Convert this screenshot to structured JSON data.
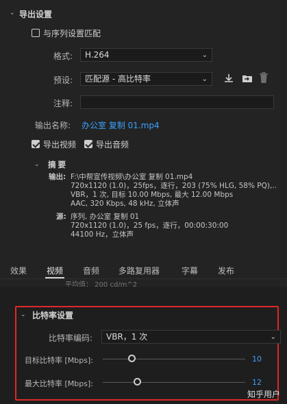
{
  "export": {
    "section_title": "导出设置",
    "match_sequence_label": "与序列设置匹配",
    "format_label": "格式:",
    "format_value": "H.264",
    "preset_label": "预设:",
    "preset_value": "匹配源 - 高比特率",
    "comment_label": "注释:",
    "comment_value": "",
    "output_name_label": "输出名称:",
    "output_name_value": "办公室 复制 01.mp4",
    "export_video_label": "导出视频",
    "export_audio_label": "导出音频"
  },
  "summary": {
    "title": "摘要",
    "output_label": "输出:",
    "output_lines": [
      "F:\\中帮宣传视频\\办公室 复制 01.mp4",
      "720x1120 (1.0)，25fps，逐行，203 (75% HLG, 58% PQ),..",
      "VBR，1 次, 目标 10.00 Mbps, 最大 12.00 Mbps",
      "AAC, 320 Kbps, 48  kHz, 立体声"
    ],
    "source_label": "源:",
    "source_lines": [
      "序列, 办公室 复制 01",
      "720x1120 (1.0)，25 fps，逐行，00:00:30:00",
      "44100 Hz，立体声"
    ]
  },
  "tabs": [
    {
      "label": "效果"
    },
    {
      "label": "视频"
    },
    {
      "label": "音频"
    },
    {
      "label": "多路复用器"
    },
    {
      "label": "字幕"
    },
    {
      "label": "发布"
    }
  ],
  "faded_text": "平均值：  200 cd/m^2",
  "bitrate": {
    "section_title": "比特率设置",
    "encoding_label": "比特率编码:",
    "encoding_value": "VBR，1 次",
    "target_label": "目标比特率 [Mbps]:",
    "target_value": "10",
    "max_label": "最大比特率 [Mbps]:",
    "max_value": "12"
  },
  "watermark": "知乎用户",
  "icons": {
    "download": "download-icon",
    "import": "import-preset-icon",
    "trash": "trash-icon"
  },
  "colors": {
    "accent_blue": "#3aa0ff",
    "highlight_red": "#e0282a"
  }
}
